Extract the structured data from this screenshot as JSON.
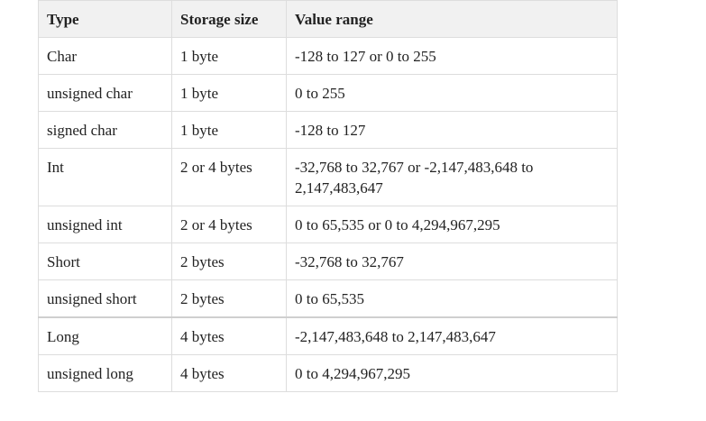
{
  "table": {
    "headers": [
      "Type",
      "Storage size",
      "Value range"
    ],
    "rows": [
      {
        "type": "Char",
        "size": "1 byte",
        "range": "-128 to 127 or 0 to 255"
      },
      {
        "type": "unsigned char",
        "size": "1 byte",
        "range": "0 to 255"
      },
      {
        "type": "signed char",
        "size": "1 byte",
        "range": "-128 to 127"
      },
      {
        "type": "Int",
        "size": "2 or 4 bytes",
        "range": "-32,768 to 32,767 or -2,147,483,648 to 2,147,483,647"
      },
      {
        "type": "unsigned int",
        "size": "2 or 4 bytes",
        "range": "0 to 65,535 or 0 to 4,294,967,295"
      },
      {
        "type": "Short",
        "size": "2 bytes",
        "range": "-32,768 to 32,767"
      },
      {
        "type": "unsigned short",
        "size": "2 bytes",
        "range": "0 to 65,535"
      },
      {
        "type": "Long",
        "size": "4 bytes",
        "range": "-2,147,483,648 to 2,147,483,647"
      },
      {
        "type": "unsigned long",
        "size": "4 bytes",
        "range": "0 to 4,294,967,295"
      }
    ]
  },
  "colors": {
    "header_bg": "#f1f1f1",
    "border": "#dddddd",
    "text": "#222222"
  }
}
